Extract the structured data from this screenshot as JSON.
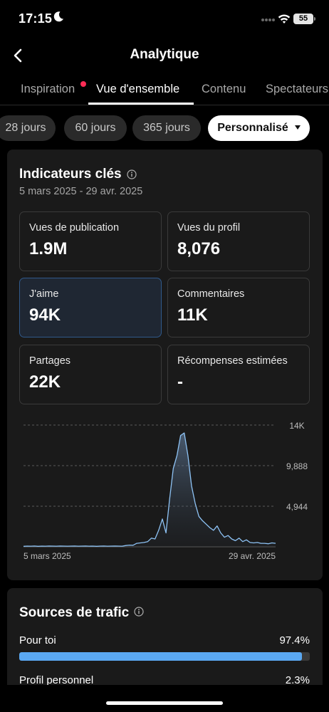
{
  "status": {
    "time": "17:15",
    "battery": "55"
  },
  "nav": {
    "title": "Analytique"
  },
  "tabs": [
    {
      "label": "Inspiration"
    },
    {
      "label": "Vue d'ensemble"
    },
    {
      "label": "Contenu"
    },
    {
      "label": "Spectateurs"
    }
  ],
  "chips": [
    {
      "label": "28 jours"
    },
    {
      "label": "60 jours"
    },
    {
      "label": "365 jours"
    },
    {
      "label": "Personnalisé"
    }
  ],
  "key_metrics": {
    "title": "Indicateurs clés",
    "date_range": "5 mars 2025 - 29 avr. 2025",
    "items": [
      {
        "label": "Vues de publication",
        "value": "1.9M"
      },
      {
        "label": "Vues du profil",
        "value": "8,076"
      },
      {
        "label": "J'aime",
        "value": "94K"
      },
      {
        "label": "Commentaires",
        "value": "11K"
      },
      {
        "label": "Partages",
        "value": "22K"
      },
      {
        "label": "Récompenses estimées",
        "value": "-"
      }
    ]
  },
  "chart_data": {
    "type": "area",
    "title": "",
    "series": [
      {
        "values": [
          60,
          80,
          70,
          90,
          60,
          80,
          70,
          90,
          80,
          70,
          90,
          80,
          70,
          80,
          90,
          70,
          80,
          90,
          70,
          80,
          60,
          80,
          90,
          70,
          80,
          90,
          80,
          70,
          150,
          200,
          180,
          400,
          450,
          500,
          600,
          1000,
          900,
          1900,
          3200,
          1600,
          5500,
          9000,
          10500,
          12800,
          13100,
          10500,
          7000,
          5000,
          3500,
          3000,
          2600,
          2200,
          1900,
          2400,
          1600,
          1100,
          1300,
          900,
          700,
          1000,
          600,
          800,
          500,
          450,
          500,
          400,
          400,
          350,
          450,
          400
        ]
      }
    ],
    "x_labels": [
      "5 mars 2025",
      "29 avr. 2025"
    ],
    "y_ticks": [
      "14K",
      "9,888",
      "4,944"
    ],
    "ylim": [
      0,
      14000
    ],
    "colors": {
      "line": "#8ec3f5"
    }
  },
  "traffic": {
    "title": "Sources de trafic",
    "items": [
      {
        "label": "Pour toi",
        "pct": "97.4%",
        "fill": 97.4
      },
      {
        "label": "Profil personnel",
        "pct": "2.3%",
        "fill": 2.3
      }
    ]
  }
}
